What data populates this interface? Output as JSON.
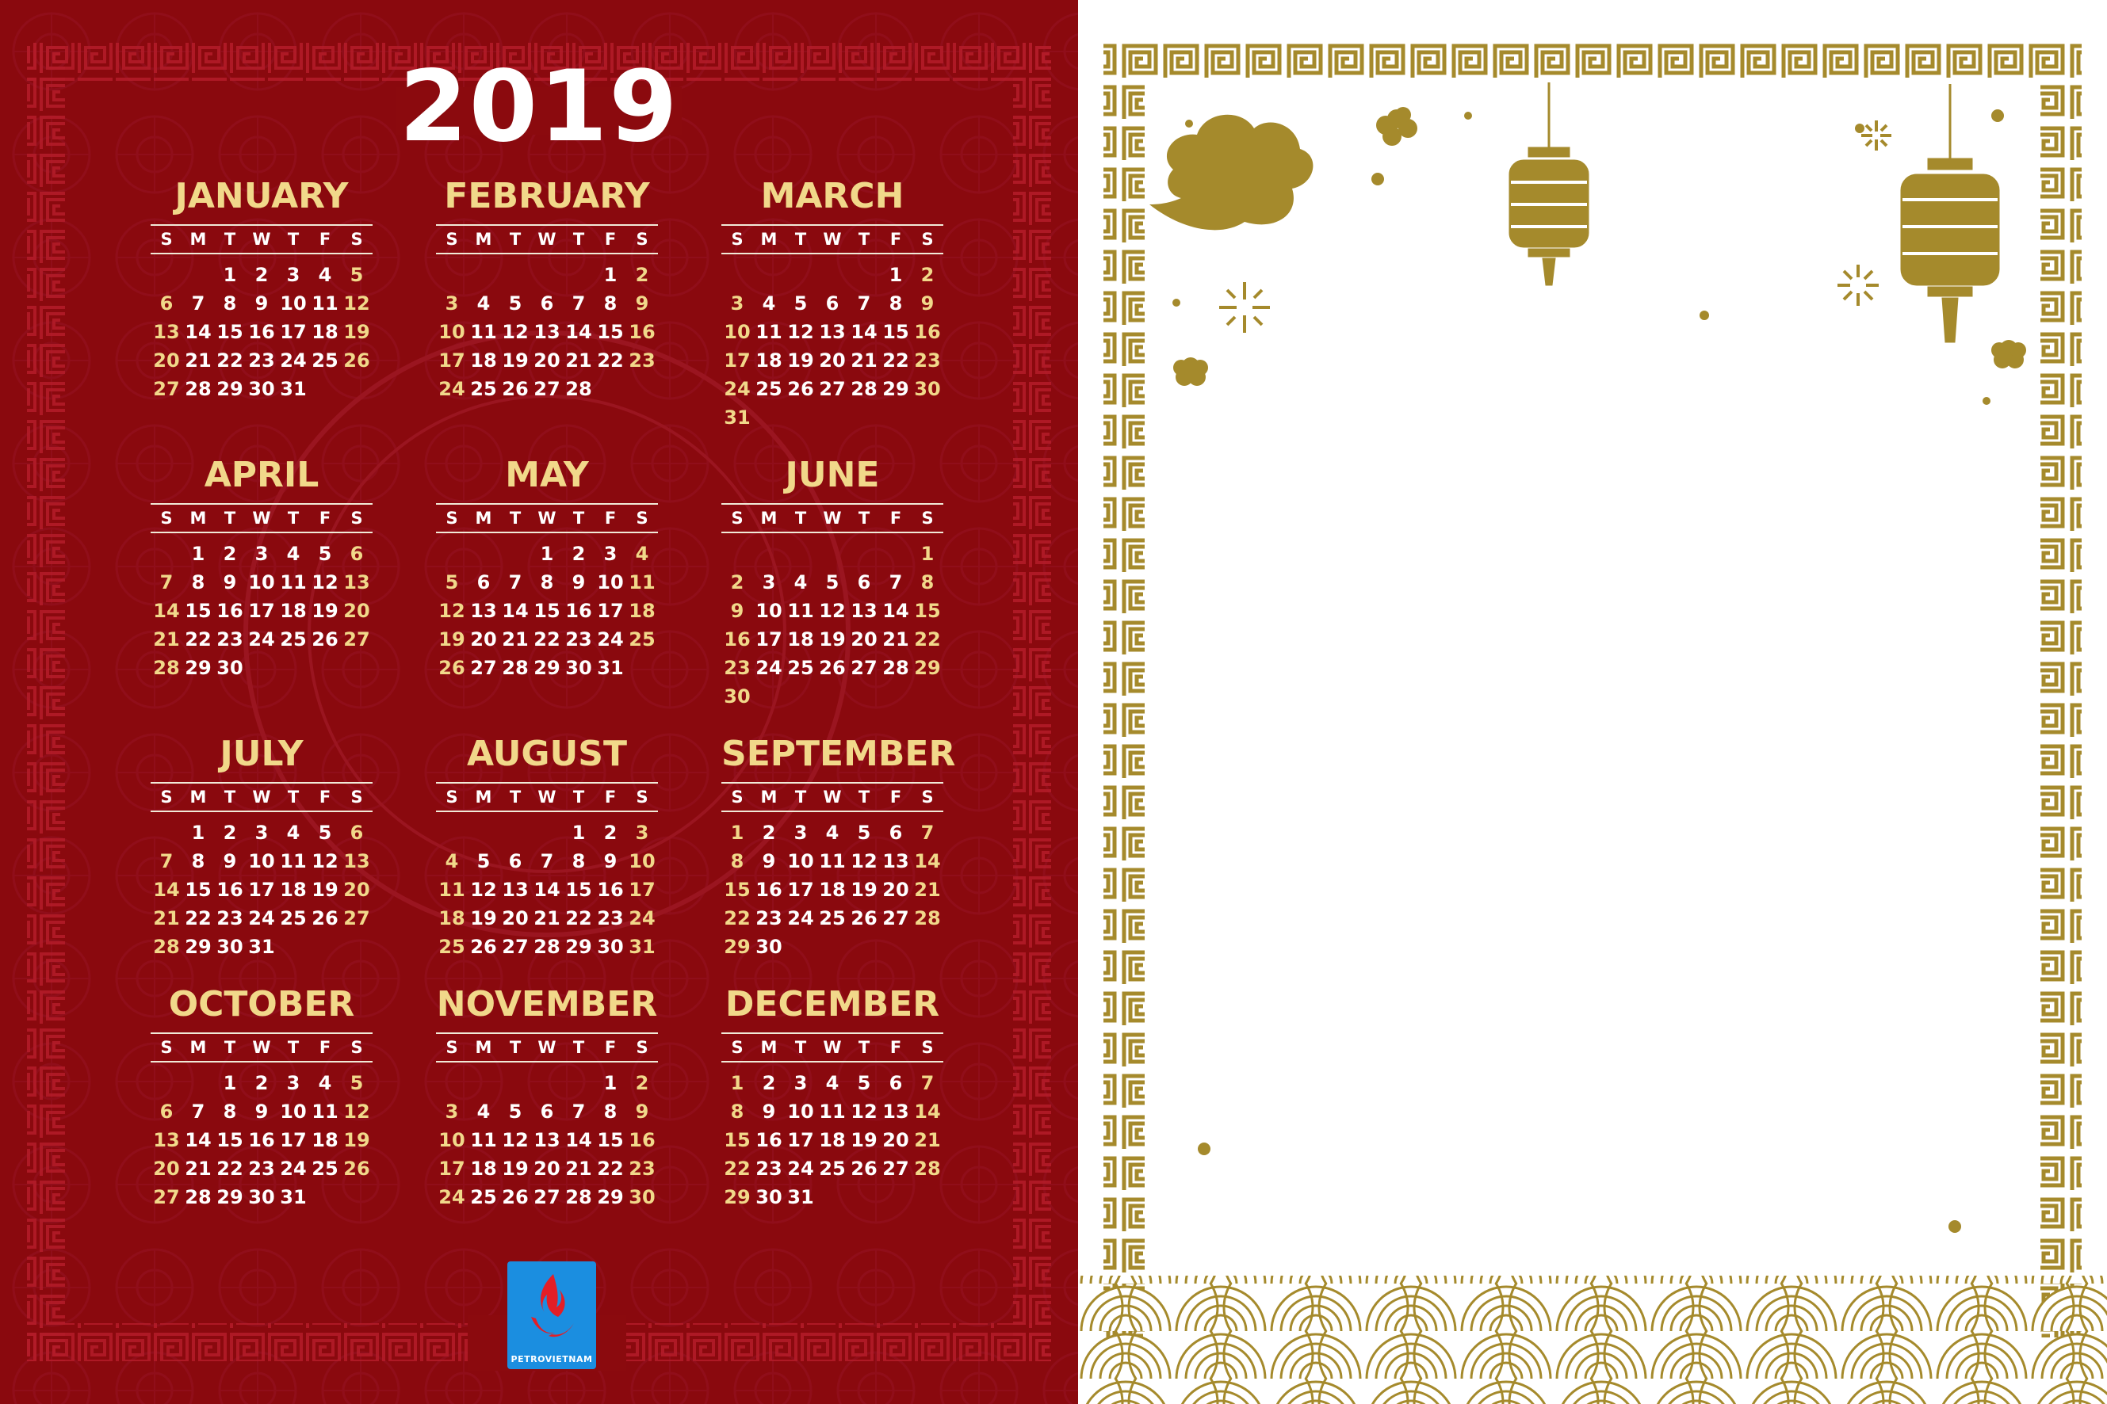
{
  "year": "2019",
  "weekday_headers": [
    "S",
    "M",
    "T",
    "W",
    "T",
    "F",
    "S"
  ],
  "months": [
    {
      "name": "JANUARY",
      "start": 2,
      "days": 31
    },
    {
      "name": "FEBRUARY",
      "start": 5,
      "days": 28
    },
    {
      "name": "MARCH",
      "start": 5,
      "days": 31
    },
    {
      "name": "APRIL",
      "start": 1,
      "days": 30
    },
    {
      "name": "MAY",
      "start": 3,
      "days": 31
    },
    {
      "name": "JUNE",
      "start": 6,
      "days": 30
    },
    {
      "name": "JULY",
      "start": 1,
      "days": 31
    },
    {
      "name": "AUGUST",
      "start": 4,
      "days": 31
    },
    {
      "name": "SEPTEMBER",
      "start": 0,
      "days": 30
    },
    {
      "name": "OCTOBER",
      "start": 2,
      "days": 31
    },
    {
      "name": "NOVEMBER",
      "start": 5,
      "days": 30
    },
    {
      "name": "DECEMBER",
      "start": 0,
      "days": 31
    }
  ],
  "logo": {
    "text": "PETROVIETNAM",
    "icon": "flame-logo-icon"
  },
  "colors": {
    "background": "#8b0a0e",
    "gold": "#f1d88a",
    "white": "#ffffff",
    "ornament": "#a58a2c",
    "logo_blue": "#1b8ee0"
  },
  "decorations": [
    "greek-key-border-icon",
    "cloud-icon",
    "lantern-icon",
    "plum-blossom-icon",
    "sparkle-icon",
    "wave-scale-icon"
  ]
}
